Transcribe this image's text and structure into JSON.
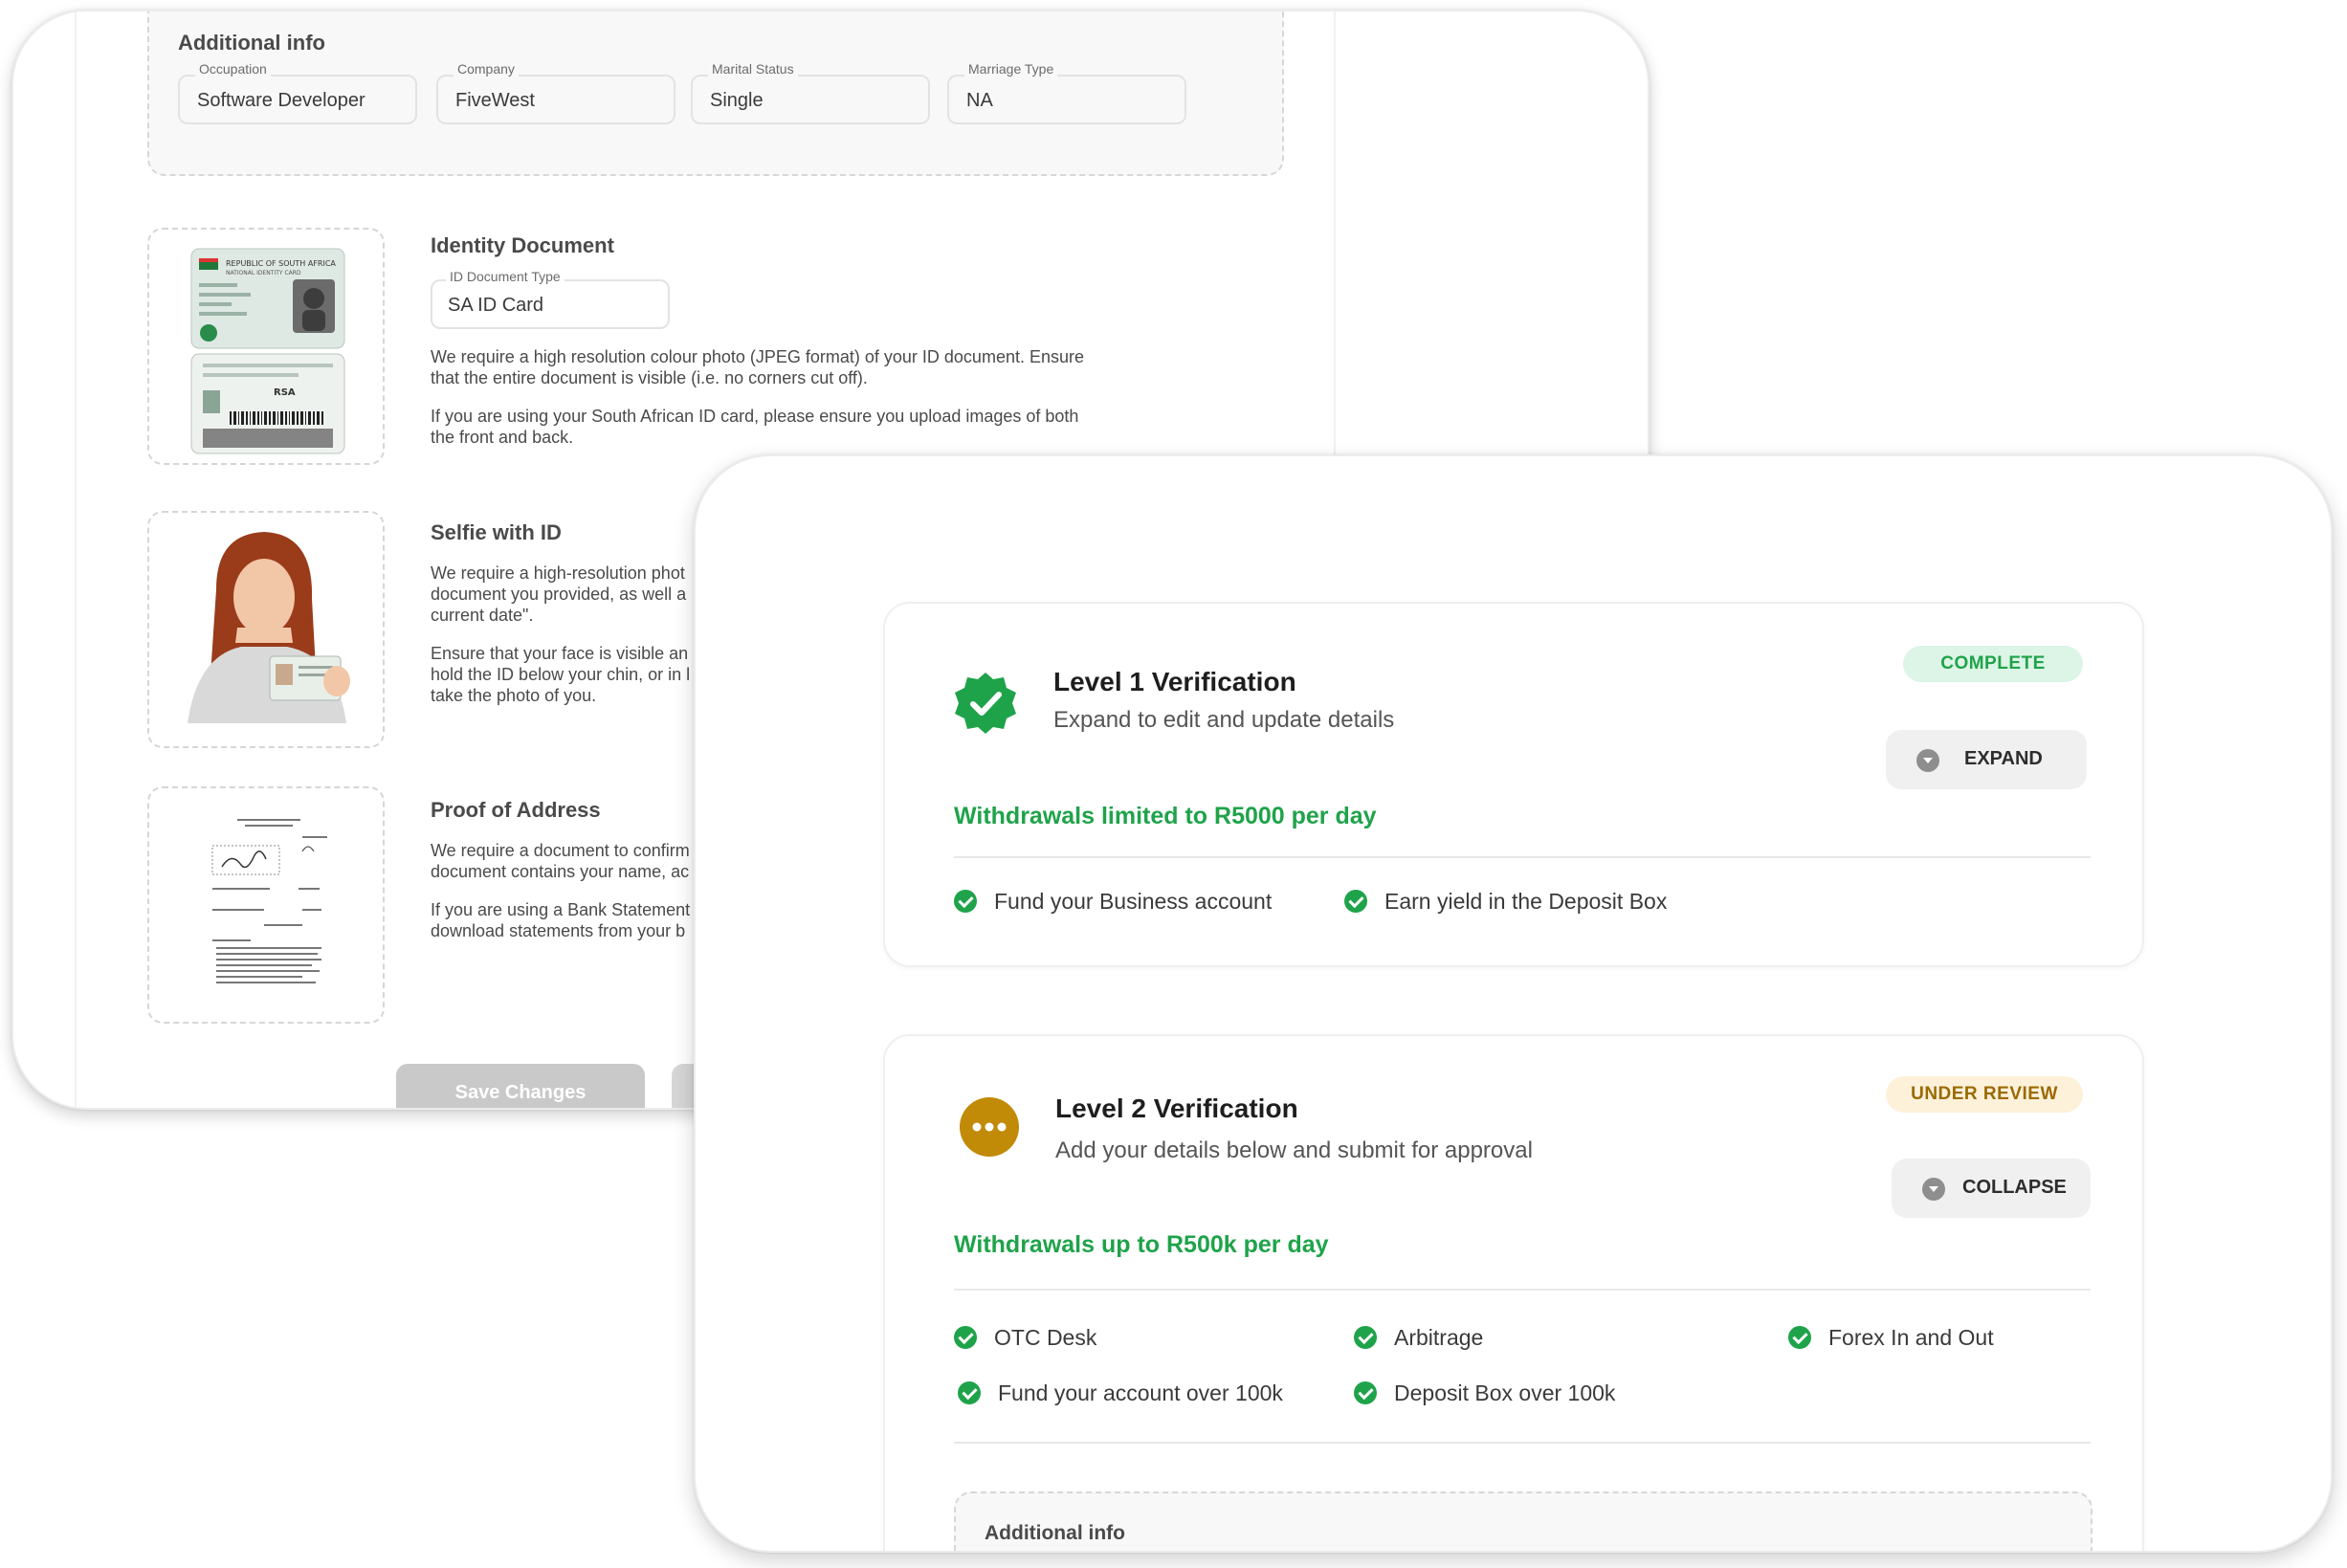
{
  "back_panel": {
    "additional_info": {
      "title": "Additional info",
      "fields": [
        {
          "label": "Occupation",
          "value": "Software Developer"
        },
        {
          "label": "Company",
          "value": "FiveWest"
        },
        {
          "label": "Marital Status",
          "value": "Single"
        },
        {
          "label": "Marriage Type",
          "value": "NA"
        }
      ]
    },
    "identity": {
      "title": "Identity Document",
      "id_type_label": "ID Document Type",
      "id_type_value": "SA ID Card",
      "para1": "We require a high resolution colour photo (JPEG format) of your ID document. Ensure that the entire document is visible (i.e. no corners cut off).",
      "para2": "If you are using your South African ID card, please ensure you upload images of both the front and back.",
      "card_header": "REPUBLIC OF SOUTH AFRICA",
      "card_subheader": "NATIONAL IDENTITY CARD",
      "card_back_code": "RSA"
    },
    "selfie": {
      "title": "Selfie with ID",
      "para1": "We require a high-resolution phot document you provided, as well a current date\".",
      "para2": "Ensure that your face is visible an hold the ID below your chin, or in l take the photo of you."
    },
    "address": {
      "title": "Proof of Address",
      "para1": "We require a document to confirm document contains your name, ac",
      "para2": "If you are using a Bank Statement download statements from your b"
    },
    "save_label": "Save Changes"
  },
  "front_panel": {
    "level1": {
      "title": "Level 1 Verification",
      "subtitle": "Expand to edit and update details",
      "status": "COMPLETE",
      "button": "EXPAND",
      "limit": "Withdrawals limited to R5000 per day",
      "features": [
        "Fund your Business account",
        "Earn yield in the Deposit Box"
      ]
    },
    "level2": {
      "title": "Level 2 Verification",
      "subtitle": "Add your details below and submit for approval",
      "status": "UNDER REVIEW",
      "button": "COLLAPSE",
      "limit": "Withdrawals up to R500k per day",
      "features": [
        "OTC Desk",
        "Arbitrage",
        "Forex In and Out",
        "Fund your account over 100k",
        "Deposit Box over 100k"
      ],
      "additional_info_title": "Additional info"
    }
  },
  "colors": {
    "success_green": "#1fa34a",
    "review_amber": "#c18a07",
    "button_grey": "#f0f0f0"
  },
  "icons": {
    "level1": "verified-badge-icon",
    "level2": "pending-dots-icon",
    "buttons": "chevron-circle-icon",
    "features": "check-circle-icon"
  }
}
